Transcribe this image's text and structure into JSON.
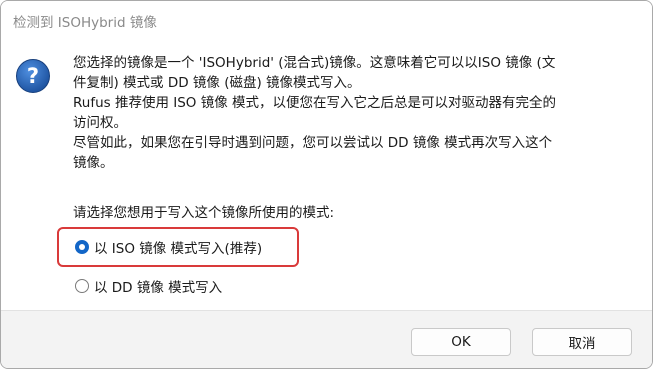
{
  "window": {
    "title": "检测到 ISOHybrid 镜像"
  },
  "icon": {
    "name": "question-icon",
    "color": "#1f5fb3"
  },
  "message": {
    "line1": "您选择的镜像是一个 'ISOHybrid' (混合式)镜像。这意味着它可以以ISO 镜像 (文",
    "line2": "件复制) 模式或 DD 镜像 (磁盘) 镜像模式写入。",
    "line3": "Rufus 推荐使用 ISO 镜像 模式，以便您在写入它之后总是可以对驱动器有完全的",
    "line4": "访问权。",
    "line5": "尽管如此，如果您在引导时遇到问题，您可以尝试以 DD 镜像 模式再次写入这个",
    "line6": "镜像。"
  },
  "prompt": "请选择您想用于写入这个镜像所使用的模式:",
  "options": [
    {
      "label": "以 ISO 镜像 模式写入(推荐)",
      "selected": true
    },
    {
      "label": "以 DD 镜像 模式写入",
      "selected": false
    }
  ],
  "buttons": {
    "ok": "OK",
    "cancel": "取消"
  },
  "colors": {
    "highlight_border": "#d93a3a",
    "radio_selected": "#1366c7"
  }
}
